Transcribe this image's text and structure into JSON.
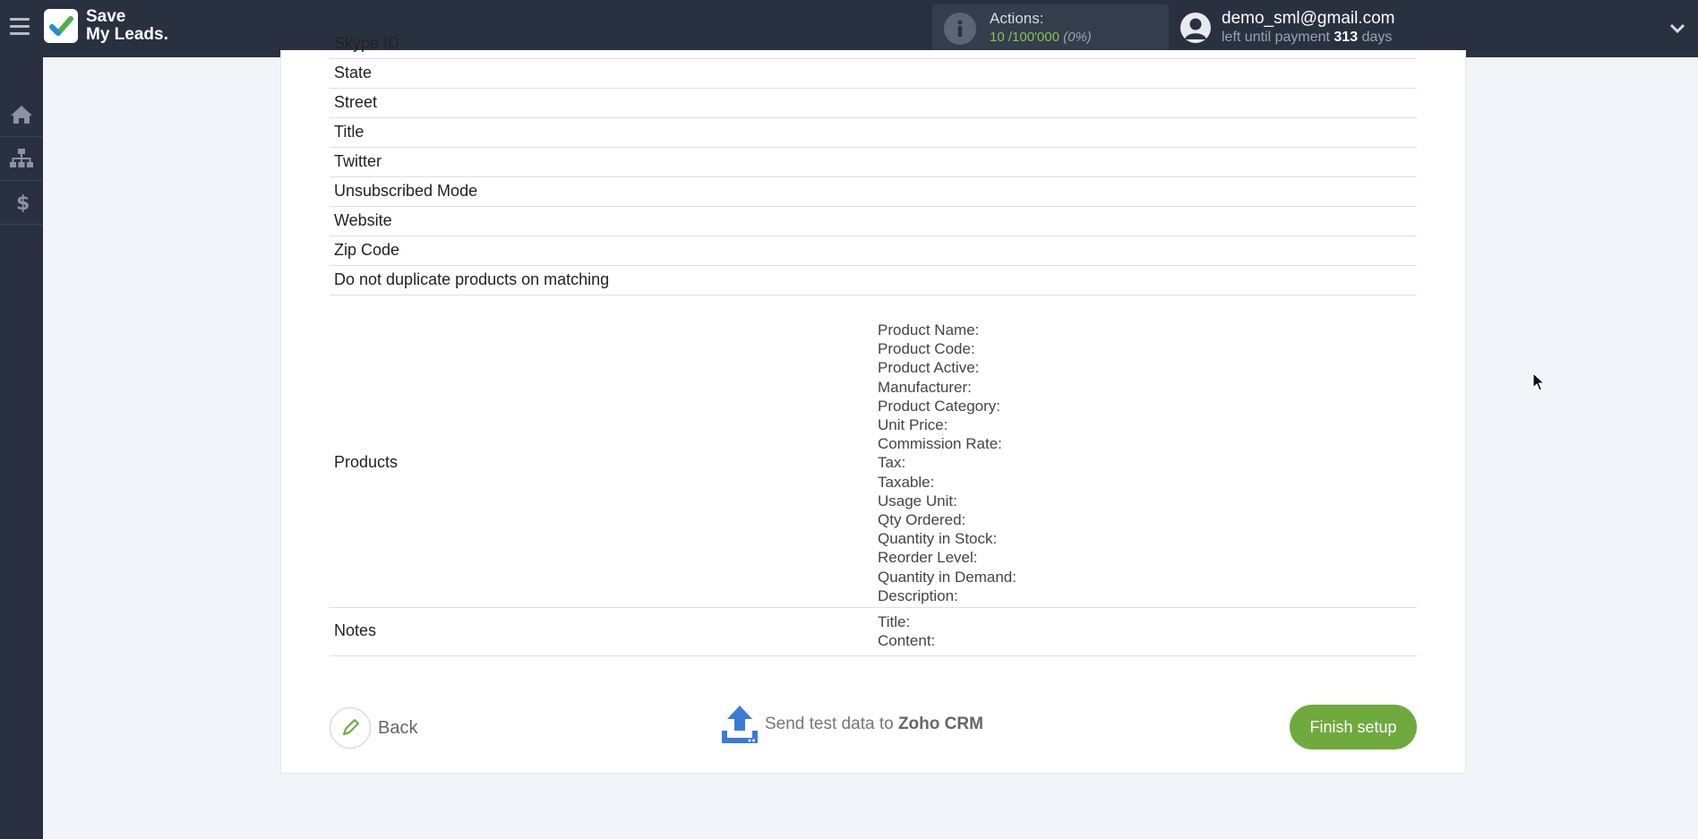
{
  "header": {
    "logo_line1": "Save",
    "logo_line2": "My Leads.",
    "actions_label": "Actions:",
    "actions_used": "10",
    "actions_total": "/100'000",
    "actions_pct": "(0%)",
    "user_email": "demo_sml@gmail.com",
    "payment_prefix": "left until payment",
    "payment_days": "313",
    "payment_suffix": "days"
  },
  "sidebar": {
    "items": [
      {
        "icon": "home-icon"
      },
      {
        "icon": "sitemap-icon"
      },
      {
        "icon": "dollar-icon"
      }
    ]
  },
  "table": {
    "rows": [
      {
        "key": "Skype ID"
      },
      {
        "key": "State"
      },
      {
        "key": "Street"
      },
      {
        "key": "Title"
      },
      {
        "key": "Twitter"
      },
      {
        "key": "Unsubscribed Mode"
      },
      {
        "key": "Website"
      },
      {
        "key": "Zip Code"
      },
      {
        "key": "Do not duplicate products on matching"
      }
    ],
    "products": {
      "key": "Products",
      "values": [
        "Product Name:",
        "Product Code:",
        "Product Active:",
        "Manufacturer:",
        "Product Category:",
        "Unit Price:",
        "Commission Rate:",
        "Tax:",
        "Taxable:",
        "Usage Unit:",
        "Qty Ordered:",
        "Quantity in Stock:",
        "Reorder Level:",
        "Quantity in Demand:",
        "Description:"
      ]
    },
    "notes": {
      "key": "Notes",
      "values": [
        "Title:",
        "Content:"
      ]
    }
  },
  "footer": {
    "back_label": "Back",
    "send_prefix": "Send test data to",
    "send_target": "Zoho CRM",
    "finish_label": "Finish setup"
  },
  "colors": {
    "topbar": "#293140",
    "accent_green": "#6faa3e",
    "actions_green": "#8cc14c"
  }
}
